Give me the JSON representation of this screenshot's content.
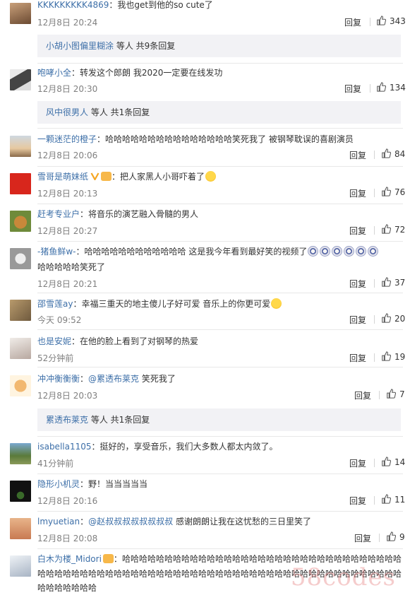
{
  "reply_label": "回复",
  "comments": [
    {
      "user": "KKKKKKKKK4869",
      "text": "我也get到他的so cute了",
      "time": "12月8日 20:24",
      "likes": "343"
    },
    {
      "user": "咆哮小全",
      "text": "转发这个郎朗 我2020一定要在线发功",
      "time": "12月8日 20:30",
      "likes": "134"
    },
    {
      "user": "一颗迷茫的橙子",
      "text": "哈哈哈哈哈哈哈哈哈哈哈哈哈哈哈笑死我了 被钢琴耽误的喜剧演员",
      "time": "12月8日 20:06",
      "likes": "84"
    },
    {
      "user": "雪哥是萌妹纸",
      "text": "把人家黑人小哥吓着了",
      "time": "12月8日 20:13",
      "likes": "76"
    },
    {
      "user": "赶考专业户",
      "text": "将音乐的演艺融入骨髓的男人",
      "time": "12月8日 20:27",
      "likes": "72"
    },
    {
      "user": "-猪鱼鲜w-",
      "text": "哈哈哈哈哈哈哈哈哈哈哈哈 这是我今年看到最好笑的视频了",
      "text2": "哈哈哈哈哈笑死了",
      "time": "12月8日 20:21",
      "likes": "37"
    },
    {
      "user": "邵雪莲ay",
      "text": "幸福三重天的地主傻儿子好可爱 音乐上的你更可爱",
      "time": "今天 09:52",
      "likes": "20"
    },
    {
      "user": "也是安妮",
      "text": "在他的脸上看到了对钢琴的热爱",
      "time": "52分钟前",
      "likes": "19"
    },
    {
      "user": "冲冲衡衡衡",
      "mention": "@累透布莱克",
      "text": "笑死我了",
      "time": "12月8日 20:03",
      "likes": "7"
    },
    {
      "user": "isabella1105",
      "text": "挺好的，享受音乐，我们大多数人都太内敛了。",
      "time": "41分钟前",
      "likes": "14"
    },
    {
      "user": "隐形小机灵",
      "text": "野！当当当当当",
      "time": "12月8日 20:16",
      "likes": "11"
    },
    {
      "user": "lmyuetian",
      "mention": "@赵叔叔叔叔叔叔叔叔",
      "text": "感谢朗朗让我在这忧愁的三日里笑了",
      "time": "12月8日 20:08",
      "likes": "9"
    },
    {
      "user": "白木为楼_Midori",
      "text": "哈哈哈哈哈哈哈哈哈哈哈哈哈哈哈哈哈哈哈哈哈哈哈哈哈哈哈哈哈哈哈哈哈哈哈哈哈哈哈哈哈哈哈哈哈哈哈哈哈哈哈哈哈哈哈哈哈哈哈哈哈哈哈哈哈哈哈哈哈哈哈哈哈哈哈哈哈哈哈哈哈哈哈"
    }
  ],
  "reply_boxes": [
    {
      "name": "小胡小图偏里糊涂",
      "suffix": "等人 共9条回复"
    },
    {
      "name": "风中很男人",
      "suffix": "等人 共1条回复"
    },
    {
      "name": "累透布莱克",
      "suffix": "等人 共1条回复"
    }
  ],
  "watermark": "58codes"
}
